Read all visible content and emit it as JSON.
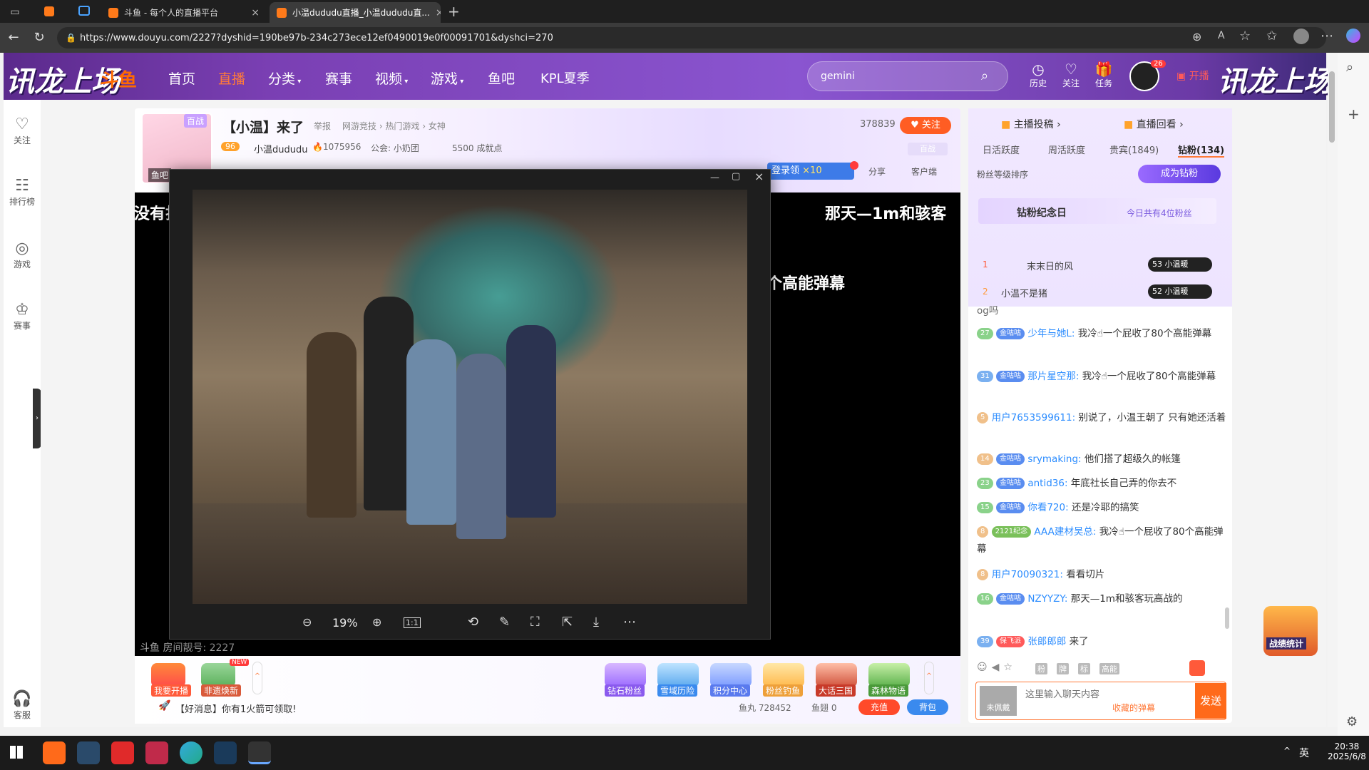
{
  "browser": {
    "tabs": [
      {
        "label": "斗鱼 - 每个人的直播平台"
      },
      {
        "label": "小温dududu直播_小温dududu直..."
      }
    ],
    "url": "https://www.douyu.com/2227?dyshid=190be97b-234c273ece12ef0490019e0f00091701&dyshci=270"
  },
  "header": {
    "logo": "斗鱼",
    "nav": [
      "首页",
      "直播",
      "分类",
      "赛事",
      "视频",
      "游戏",
      "鱼吧",
      "KPL夏季"
    ],
    "search_value": "gemini",
    "icons": [
      {
        "label": "历史"
      },
      {
        "label": "关注"
      },
      {
        "label": "任务"
      }
    ],
    "avatar_badge": "26",
    "start_label": "开播",
    "banner_text": "讯龙上场"
  },
  "sidebar": {
    "items": [
      {
        "label": "关注",
        "icon": "heart-icon"
      },
      {
        "label": "排行榜",
        "icon": "rank-icon"
      },
      {
        "label": "游戏",
        "icon": "game-icon"
      },
      {
        "label": "赛事",
        "icon": "trophy-icon"
      },
      {
        "label": "客服",
        "icon": "headset-icon"
      }
    ]
  },
  "room": {
    "title": "【小温】来了",
    "report": "举报",
    "category": "网游竞技 › 热门游戏 › 女神",
    "viewers": "378839",
    "follow": "关注",
    "level": "96",
    "streamer": "小温dududu",
    "heat": "1075956",
    "guild": "公会: 小奶团",
    "achievement": "5500 成就点",
    "share": "分享",
    "client": "客户端",
    "baizhan": "百战",
    "login_gift": "登录领",
    "gift_count": "×10",
    "fishbar": "鱼吧"
  },
  "video": {
    "overlay_left": "没有打",
    "overlay_right": "那天—1m和骇客",
    "overlay_mid": "个高能弹幕",
    "room_no": "斗鱼 房间靓号: 2227"
  },
  "viewer": {
    "zoom": "19%"
  },
  "bottom": {
    "items": [
      {
        "label": "我要开播"
      },
      {
        "label": "非遗焕新",
        "badge": "NEW"
      },
      {
        "label": "钻石粉丝"
      },
      {
        "label": "雪域历险"
      },
      {
        "label": "积分中心"
      },
      {
        "label": "粉丝钓鱼"
      },
      {
        "label": "大话三国"
      },
      {
        "label": "森林物语"
      }
    ],
    "notice": "【好消息】你有1火箭可领取!",
    "fish_balls": "鱼丸 728452",
    "fish_fins": "鱼翅 0",
    "recharge": "充值",
    "backpack": "背包"
  },
  "rpanel": {
    "post": "主播投稿",
    "replay": "直播回看",
    "tabs": [
      "日活跃度",
      "周活跃度",
      "贵宾(1849)",
      "钻粉(134)"
    ],
    "rank_label": "粉丝等级排序",
    "become": "成为钻粉",
    "memorial": "钻粉纪念日",
    "today": "今日共有4位粉丝",
    "rank": [
      {
        "n": "1",
        "name": "末末日的风",
        "lv": "53",
        "tag": "小温暖"
      },
      {
        "n": "2",
        "name": "小温不是猪",
        "lv": "52",
        "tag": "小温暖"
      }
    ],
    "chat_top": "og吗",
    "chat": [
      {
        "lv": "27",
        "fan": "金咕咕",
        "user": "少年与她L:",
        "text": "我冷☝一个屁收了80个高能弹幕"
      },
      {
        "lv": "31",
        "fan": "金咕咕",
        "user": "那片星空那:",
        "text": "我冷☝一个屁收了80个高能弹幕"
      },
      {
        "lv": "5",
        "fan": "",
        "user": "用户7653599611:",
        "text": "别说了，小温王朝了 只有她还活着"
      },
      {
        "lv": "14",
        "fan": "金咕咕",
        "user": "srymaking:",
        "text": "他们搭了超级久的帐篷"
      },
      {
        "lv": "23",
        "fan": "金咕咕",
        "user": "antid36:",
        "text": "年底社长自己弄的你去不"
      },
      {
        "lv": "15",
        "fan": "金咕咕",
        "user": "你看720:",
        "text": "还是冷耶的搞笑"
      },
      {
        "lv": "8",
        "fan": "2121纪念",
        "user": "AAA建材吴总:",
        "text": "我冷☝一个屁收了80个高能弹幕"
      },
      {
        "lv": "8",
        "fan": "",
        "user": "用户70090321:",
        "text": "看看切片"
      },
      {
        "lv": "16",
        "fan": "金咕咕",
        "user": "NZYYZY:",
        "text": "那天—1m和骇客玩高战的"
      },
      {
        "lv": "39",
        "fan": "保飞派",
        "user": "张郎郎郎",
        "text": "来了"
      }
    ],
    "tools": [
      "粉",
      "牌",
      "标",
      "高能"
    ],
    "not_worn": "未佩戴",
    "input_placeholder": "这里输入聊天内容",
    "favorite": "收藏的弹幕",
    "send": "发送"
  },
  "right_float": "战绩统计",
  "taskbar": {
    "ime": "英",
    "time": "20:38",
    "date": "2025/6/8"
  }
}
